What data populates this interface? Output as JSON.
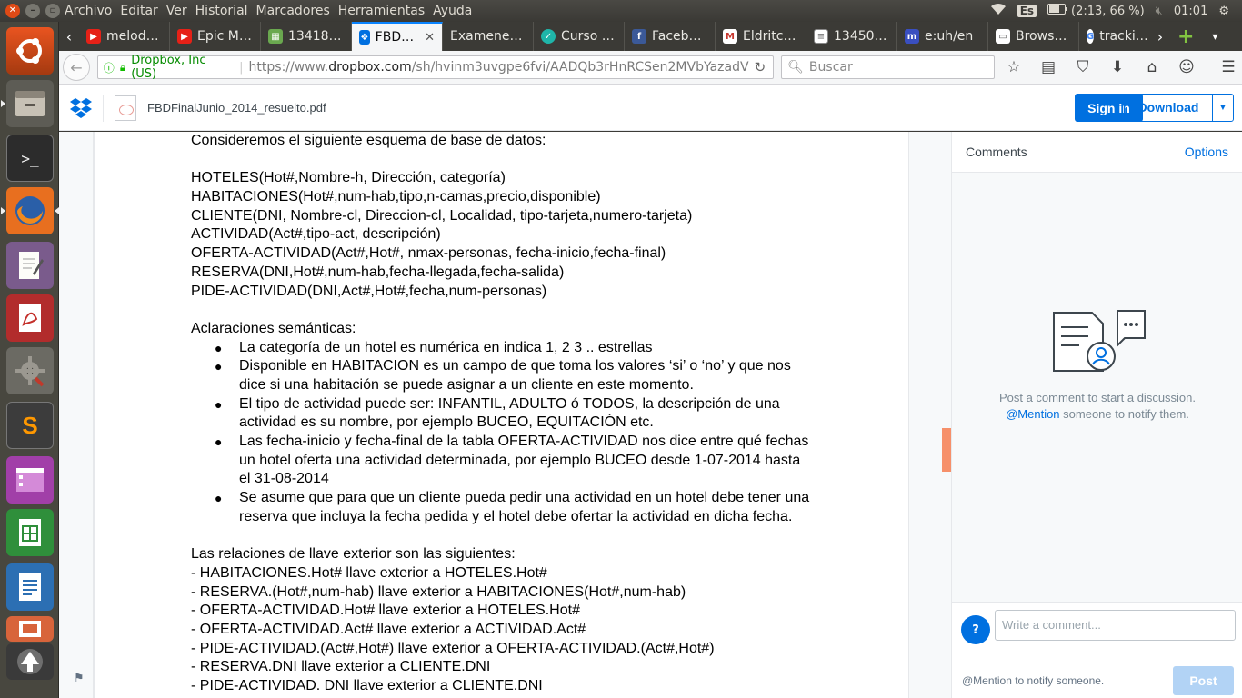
{
  "system_menu": {
    "items": [
      "Archivo",
      "Editar",
      "Ver",
      "Historial",
      "Marcadores",
      "Herramientas",
      "Ayuda"
    ],
    "lang": "Es",
    "battery": "(2:13, 66 %)",
    "clock": "01:01"
  },
  "tabs": [
    {
      "label": "melod…",
      "icon": "youtube-icon",
      "color": "#e62117"
    },
    {
      "label": "Epic M…",
      "icon": "youtube-icon",
      "color": "#e62117"
    },
    {
      "label": "13418…",
      "icon": "image-icon",
      "color": "#6aa84f"
    },
    {
      "label": "FBD…",
      "icon": "dropbox-icon",
      "color": "#0070e0",
      "active": true
    },
    {
      "label": "Examene…",
      "icon": "",
      "color": ""
    },
    {
      "label": "Curso …",
      "icon": "course-icon",
      "color": "#1fb5a9"
    },
    {
      "label": "Faceb…",
      "icon": "facebook-icon",
      "color": "#3b5998"
    },
    {
      "label": "Eldritc…",
      "icon": "mendeley-icon",
      "color": "#c7372f"
    },
    {
      "label": "13450…",
      "icon": "document-icon",
      "color": "#888888"
    },
    {
      "label": "e:uh/en",
      "icon": "m-icon",
      "color": "#3a4fc0"
    },
    {
      "label": "Brows…",
      "icon": "folder-icon",
      "color": "#555555"
    },
    {
      "label": "tracki…",
      "icon": "google-icon",
      "color": "#4285f4"
    }
  ],
  "address": {
    "org": "Dropbox, Inc (US)",
    "url_prefix": "https://www.",
    "url_domain": "dropbox.com",
    "url_rest": "/sh/hvinm3uvgpe6fvi/AADQb3rHnRCSen2MVbYazadV",
    "search_placeholder": "Buscar"
  },
  "dropbox": {
    "filename": "FBDFinalJunio_2014_resuelto.pdf",
    "signin_label": "Sign in",
    "download_label": "Download"
  },
  "document": {
    "intro": "Consideremos el siguiente esquema de base de datos:",
    "schema": [
      "HOTELES(Hot#,Nombre-h, Dirección, categoría)",
      "HABITACIONES(Hot#,num-hab,tipo,n-camas,precio,disponible)",
      "CLIENTE(DNI, Nombre-cl, Direccion-cl, Localidad, tipo-tarjeta,numero-tarjeta)",
      "ACTIVIDAD(Act#,tipo-act, descripción)",
      "OFERTA-ACTIVIDAD(Act#,Hot#, nmax-personas, fecha-inicio,fecha-final)",
      "RESERVA(DNI,Hot#,num-hab,fecha-llegada,fecha-salida)",
      "PIDE-ACTIVIDAD(DNI,Act#,Hot#,fecha,num-personas)"
    ],
    "aclaraciones_title": "Aclaraciones semánticas:",
    "bullets": [
      "La categoría de un hotel es numérica en indica 1, 2 3 .. estrellas",
      "Disponible en HABITACION es un campo de que toma los valores ‘si’ o ‘no’ y que nos dice si una habitación se puede asignar a un cliente en este momento.",
      "El tipo de actividad puede ser: INFANTIL, ADULTO ó TODOS, la descripción de una actividad es su nombre, por ejemplo BUCEO, EQUITACIÓN etc.",
      "Las  fecha-inicio y fecha-final de la tabla OFERTA-ACTIVIDAD nos dice entre qué fechas un hotel oferta una actividad determinada, por ejemplo BUCEO desde 1-07-2014 hasta el 31-08-2014",
      "Se asume que para que un cliente pueda pedir una actividad en un hotel debe tener una reserva que incluya la fecha pedida y el hotel debe ofertar la actividad en dicha fecha."
    ],
    "fk_title": "Las relaciones de llave exterior son las siguientes:",
    "foreign_keys": [
      "- HABITACIONES.Hot#  llave exterior  a HOTELES.Hot#",
      "- RESERVA.(Hot#,num-hab)  llave exterior a  HABITACIONES(Hot#,num-hab)",
      "- OFERTA-ACTIVIDAD.Hot#  llave exterior a HOTELES.Hot#",
      "- OFERTA-ACTIVIDAD.Act#  llave exterior a ACTIVIDAD.Act#",
      "- PIDE-ACTIVIDAD.(Act#,Hot#) llave exterior a OFERTA-ACTIVIDAD.(Act#,Hot#)",
      "- RESERVA.DNI llave exterior a CLIENTE.DNI",
      "- PIDE-ACTIVIDAD. DNI llave exterior a CLIENTE.DNI"
    ]
  },
  "comments": {
    "title": "Comments",
    "options_label": "Options",
    "empty_line1": "Post a comment to start a discussion.",
    "mention_link": "@Mention",
    "empty_line2_rest": " someone to notify them.",
    "input_placeholder": "Write a comment...",
    "avatar_label": "?",
    "mention_hint": "@Mention to notify someone.",
    "post_label": "Post"
  }
}
